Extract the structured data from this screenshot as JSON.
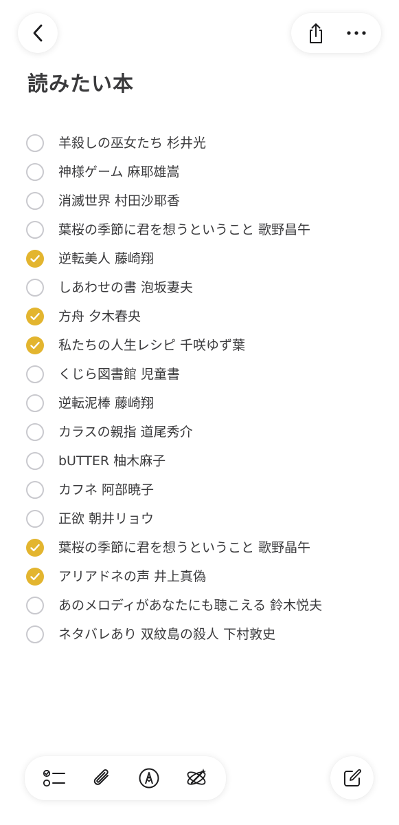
{
  "note": {
    "title": "読みたい本"
  },
  "checklist": [
    {
      "text": "羊殺しの巫女たち 杉井光",
      "checked": false
    },
    {
      "text": "神様ゲーム  麻耶雄嵩",
      "checked": false
    },
    {
      "text": "消滅世界  村田沙耶香",
      "checked": false
    },
    {
      "text": "葉桜の季節に君を想うということ  歌野昌午",
      "checked": false
    },
    {
      "text": "逆転美人  藤崎翔",
      "checked": true
    },
    {
      "text": "しあわせの書  泡坂妻夫",
      "checked": false
    },
    {
      "text": "方舟  夕木春央",
      "checked": true
    },
    {
      "text": "私たちの人生レシピ  千咲ゆず葉",
      "checked": true
    },
    {
      "text": "くじら図書館  児童書",
      "checked": false
    },
    {
      "text": "逆転泥棒 藤崎翔",
      "checked": false
    },
    {
      "text": "カラスの親指 道尾秀介",
      "checked": false
    },
    {
      "text": "bUTTER 柚木麻子",
      "checked": false
    },
    {
      "text": "カフネ 阿部暁子",
      "checked": false
    },
    {
      "text": "正欲 朝井リョウ",
      "checked": false
    },
    {
      "text": "葉桜の季節に君を想うということ 歌野晶午",
      "checked": true
    },
    {
      "text": "アリアドネの声  井上真偽",
      "checked": true
    },
    {
      "text": "あのメロディがあなたにも聴こえる 鈴木悦夫",
      "checked": false
    },
    {
      "text": "ネタバレあり 双紋島の殺人 下村敦史",
      "checked": false
    }
  ],
  "icons": {
    "back": "chevron-left-icon",
    "share": "share-icon",
    "more": "ellipsis-icon",
    "checklist": "checklist-icon",
    "attach": "paperclip-icon",
    "markup": "pen-tip-icon",
    "ai": "writing-tools-icon",
    "compose": "compose-icon"
  },
  "colors": {
    "accent": "#e3b52f",
    "unchecked_border": "#c9c9ce",
    "text": "#3a3a3c"
  }
}
